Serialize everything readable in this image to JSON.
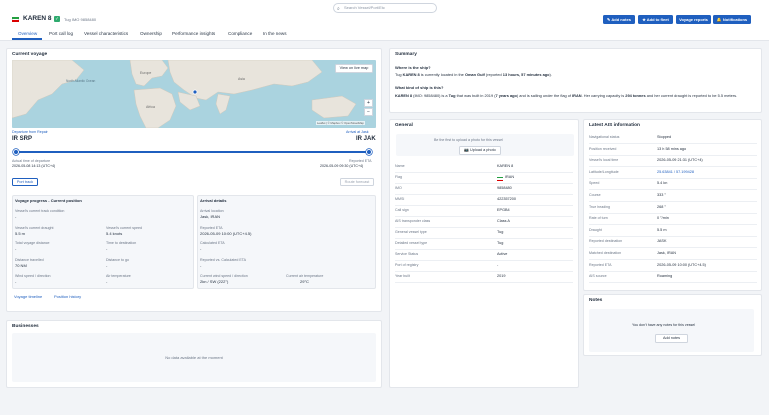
{
  "search": {
    "placeholder": "Search Vessel/Port/Etc"
  },
  "vessel": {
    "name": "KAREN 8",
    "subtitle": "Tug  IMO 9858480",
    "flag_colors": [
      "#239f40",
      "#ffffff",
      "#da0000"
    ]
  },
  "actions": {
    "add_notes": "Add notes",
    "add_to_fleet": "Add to fleet",
    "voyage_reports": "Voyage reports",
    "notifications": "Notifications"
  },
  "tabs": [
    "Overview",
    "Port call log",
    "Vessel characteristics",
    "Ownership",
    "Performance insights",
    "Compliance",
    "In the news"
  ],
  "current_voyage": {
    "title": "Current voyage",
    "map": {
      "view_on_map": "View on live map",
      "zoom_in": "+",
      "zoom_out": "−",
      "attribution": "Leaflet | © Mapbox © OpenStreetMap",
      "labels": {
        "north_atlantic": "North Atlantic Ocean",
        "europe": "Europe",
        "africa": "Africa",
        "asia": "Asia"
      }
    },
    "departure_label": "Departure from Repair",
    "departure_code": "IR SRP",
    "arrival_label": "Arrival at Jask",
    "arrival_code": "IR JAK",
    "progress_pct": 100,
    "atd_label": "Actual time of departure",
    "atd_value": "2026-05-08 14:13 (UTC+4)",
    "eta_label": "Reported ETA",
    "eta_value": "2026-05-09 09:30 (UTC+4)",
    "port_track": "Port track",
    "route_forecast": "Route forecast"
  },
  "voyage_progress": {
    "title": "Voyage progress - Current position",
    "track_condition_label": "Vessel's current track condition",
    "track_condition_value": "-",
    "current_draught_label": "Vessel's current draught",
    "current_draught_value": "5.5 m",
    "current_speed_label": "Vessel's current speed",
    "current_speed_value": "5.4 knots",
    "total_distance_label": "Total voyage distance",
    "total_distance_value": "-",
    "time_to_destination_label": "Time to destination",
    "time_to_destination_value": "-",
    "distance_travelled_label": "Distance travelled",
    "distance_travelled_value": "70 NM",
    "distance_to_go_label": "Distance to go",
    "distance_to_go_value": "-",
    "wind_label": "Wind speed / direction",
    "wind_value": "-",
    "air_temp_label": "Air temperature",
    "air_temp_value": "-"
  },
  "arrival_details": {
    "title": "Arrival details",
    "arrival_location_label": "Arrival location",
    "arrival_location_value": "Jask, IRAN",
    "reported_eta_label": "Reported ETA",
    "reported_eta_value": "2026-05-09 10:00 (UTC+4.5)",
    "calculated_eta_label": "Calculated ETA",
    "calculated_eta_value": "-",
    "reported_vs_calc_label": "Reported vs. Calculated ETA",
    "reported_vs_calc_value": "-",
    "current_wind_label": "Current wind speed / direction",
    "current_wind_value": "2kn / SW (222°)",
    "current_air_temp_label": "Current air temperature",
    "current_air_temp_value": "29°C"
  },
  "voyage_links": {
    "timeline": "Voyage timeline",
    "position_history": "Position history"
  },
  "businesses": {
    "title": "Businesses",
    "empty": "No data available at the moment"
  },
  "summary": {
    "title": "Summary",
    "q1": "Where is the ship?",
    "a1_pre": "Tug ",
    "a1_name": "KAREN 8",
    "a1_mid": " is currently located in the ",
    "a1_loc": "Oman Gulf",
    "a1_post": " (reported ",
    "a1_time": "13 hours, 57 minutes ago",
    "a1_end": ").",
    "q2": "What kind of ship is this?",
    "a2_name": "KAREN 8",
    "a2_p1": " (IMO: 9858480) is a ",
    "a2_type": "Tug",
    "a2_p2": " that was built in 2019 (",
    "a2_age": "7 years ago",
    "a2_p3": ") and is sailing under the flag of ",
    "a2_flag": "IRAN",
    "a2_p4": ". Her carrying capacity is ",
    "a2_cap": "294 tonnes",
    "a2_p5": " and her current draught is reported to be 5.5 meters."
  },
  "general": {
    "title": "General",
    "photo_text": "Be the first to upload a photo for this vessel",
    "upload_button": "Upload a photo",
    "rows": [
      {
        "label": "Name",
        "value": "KAREN 8"
      },
      {
        "label": "Flag",
        "value": "IRAN"
      },
      {
        "label": "IMO",
        "value": "9858480"
      },
      {
        "label": "MMSI",
        "value": "422357200"
      },
      {
        "label": "Call sign",
        "value": "EPGB4"
      },
      {
        "label": "AIS transponder class",
        "value": "Class A"
      },
      {
        "label": "General vessel type",
        "value": "Tug"
      },
      {
        "label": "Detailed vessel type",
        "value": "Tug"
      },
      {
        "label": "Service Status",
        "value": "Active"
      },
      {
        "label": "Port of registry",
        "value": "-"
      },
      {
        "label": "Year built",
        "value": "2019"
      }
    ]
  },
  "ais": {
    "title": "Latest AIS information",
    "rows": [
      {
        "label": "Navigational status",
        "value": "Stopped"
      },
      {
        "label": "Position received",
        "value": "13 h 58 mins ago"
      },
      {
        "label": "Vessel's local time",
        "value": "2026-05-09 21:31 (UTC+4)"
      },
      {
        "label": "Latitude/Longitude",
        "value": "25.63841 / 57.199428"
      },
      {
        "label": "Speed",
        "value": "5.4 kn"
      },
      {
        "label": "Course",
        "value": "333 °"
      },
      {
        "label": "True heading",
        "value": "268 °"
      },
      {
        "label": "Rate of turn",
        "value": "0 °/min"
      },
      {
        "label": "Draught",
        "value": "5.5 m"
      },
      {
        "label": "Reported destination",
        "value": "JASK"
      },
      {
        "label": "Matched destination",
        "value": "Jask, IRAN"
      },
      {
        "label": "Reported ETA",
        "value": "2026-05-09 10:00 (UTC+4.5)"
      },
      {
        "label": "AIS source",
        "value": "Roaming"
      }
    ]
  },
  "notes": {
    "title": "Notes",
    "empty": "You don't have any notes for this vessel",
    "add_button": "Add notes"
  },
  "colors": {
    "accent": "#1f5fbf",
    "ocean": "#aad3df",
    "land": "#e8e4dc"
  }
}
